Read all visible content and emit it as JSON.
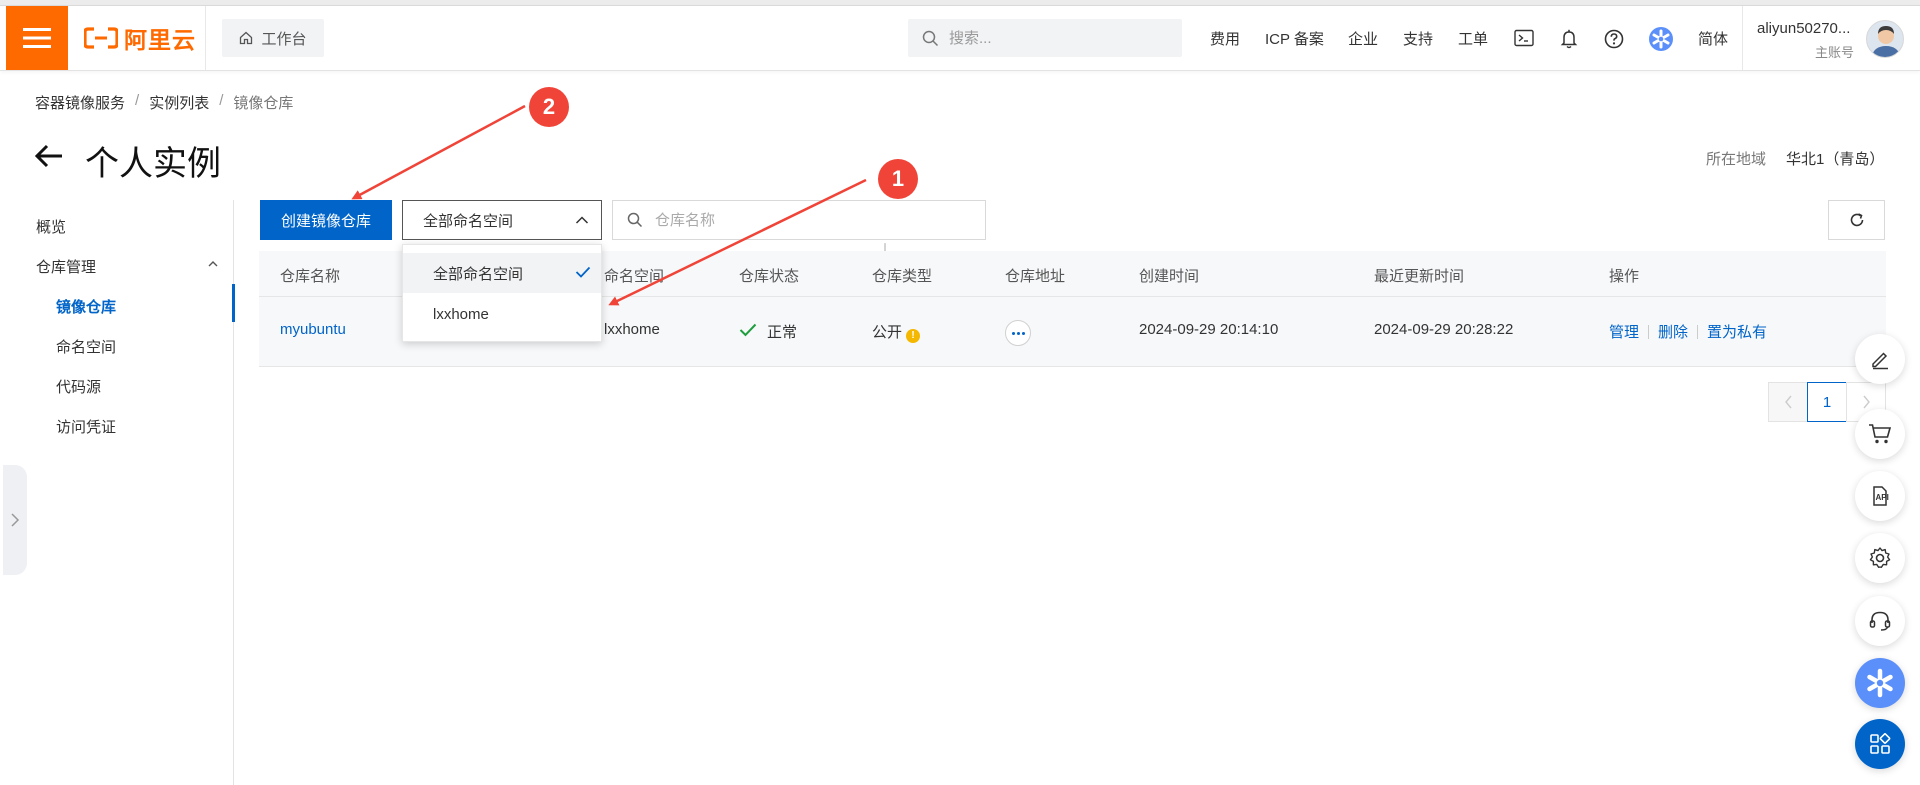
{
  "header": {
    "brand": "阿里云",
    "workbench_label": "工作台",
    "search_placeholder": "搜索...",
    "nav": [
      "费用",
      "ICP 备案",
      "企业",
      "支持",
      "工单"
    ],
    "language": "简体",
    "user_name": "aliyun50270...",
    "user_role": "主账号",
    "icons": [
      "terminal-icon",
      "bell-icon",
      "help-icon",
      "ai-assistant-icon"
    ],
    "brand_color": "#ff6a00"
  },
  "breadcrumb": [
    "容器镜像服务",
    "实例列表",
    "镜像仓库"
  ],
  "page": {
    "title": "个人实例",
    "region_label": "所在地域",
    "region_value": "华北1（青岛）"
  },
  "sidebar": {
    "overview": "概览",
    "repo_manage": "仓库管理",
    "items": [
      "镜像仓库",
      "命名空间",
      "代码源",
      "访问凭证"
    ],
    "active": "镜像仓库"
  },
  "toolbar": {
    "create_label": "创建镜像仓库",
    "namespace_selected": "全部命名空间",
    "search_placeholder": "仓库名称"
  },
  "dropdown": {
    "options": [
      "全部命名空间",
      "lxxhome"
    ],
    "selected": "全部命名空间"
  },
  "table": {
    "headers": [
      "仓库名称",
      "命名空间",
      "仓库状态",
      "仓库类型",
      "仓库地址",
      "创建时间",
      "最近更新时间",
      "操作"
    ],
    "rows": [
      {
        "name": "myubuntu",
        "namespace": "lxxhome",
        "status": "正常",
        "type": "公开",
        "created": "2024-09-29 20:14:10",
        "updated": "2024-09-29 20:28:22",
        "actions": [
          "管理",
          "删除",
          "置为私有"
        ]
      }
    ]
  },
  "pagination": {
    "current": "1"
  },
  "annotations": {
    "badge_1": "1",
    "badge_2": "2",
    "color": "#f04438"
  },
  "accent_color": "#0064c8"
}
